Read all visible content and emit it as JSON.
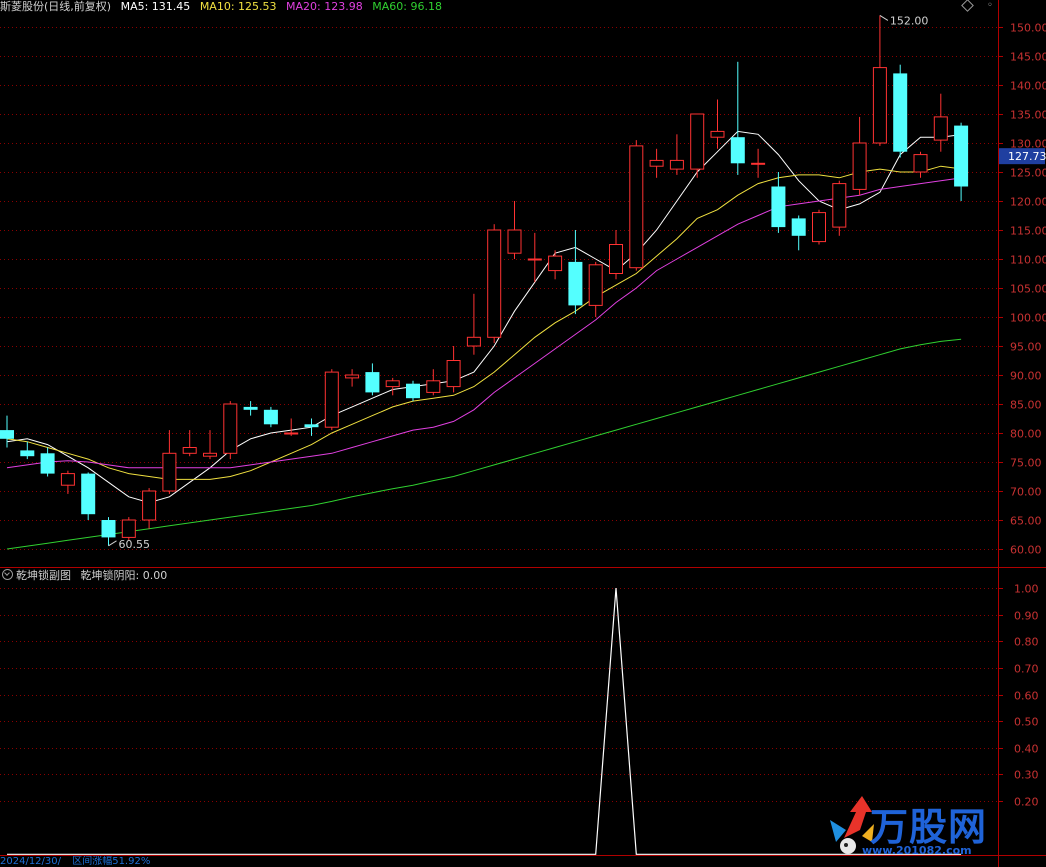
{
  "header": {
    "stock_label": "斯菱股份(日线,前复权)",
    "ma_items": [
      {
        "label": "MA5: 131.45",
        "color": "#ffffff"
      },
      {
        "label": "MA10: 125.53",
        "color": "#f0e040"
      },
      {
        "label": "MA20: 123.98",
        "color": "#e040e0"
      },
      {
        "label": "MA60: 96.18",
        "color": "#30d030"
      }
    ]
  },
  "sub_header": {
    "title": "乾坤锁副图",
    "value_label": "乾坤锁阴阳: 0.00"
  },
  "footer": {
    "date": "2024/12/30/",
    "change": "区间涨幅51.92%"
  },
  "watermark": {
    "brand": "万股网",
    "url": "www.201082.com"
  },
  "colors": {
    "up": "#ff3232",
    "down": "#54ffff",
    "grid": "#8a0000",
    "axis": "#b00000",
    "axis_text": "#c83232",
    "current_price_bg": "#1f3fa0"
  },
  "chart_data": [
    {
      "type": "candlestick",
      "title": "斯菱股份(日线,前复权)",
      "ylim": [
        57,
        155
      ],
      "y_ticks": [
        60,
        65,
        70,
        75,
        80,
        85,
        90,
        95,
        100,
        105,
        110,
        115,
        120,
        125,
        130,
        135,
        140,
        145,
        150
      ],
      "max_label": "152.00",
      "min_label": "60.55",
      "current_price_label": "127.73",
      "candles": [
        {
          "o": 80.5,
          "h": 83.0,
          "l": 77.5,
          "c": 79.0
        },
        {
          "o": 77.0,
          "h": 78.5,
          "l": 75.5,
          "c": 76.0
        },
        {
          "o": 76.5,
          "h": 77.5,
          "l": 72.5,
          "c": 73.0
        },
        {
          "o": 71.0,
          "h": 73.5,
          "l": 69.5,
          "c": 73.0
        },
        {
          "o": 73.0,
          "h": 73.2,
          "l": 65.0,
          "c": 66.0
        },
        {
          "o": 65.0,
          "h": 65.5,
          "l": 60.55,
          "c": 62.0
        },
        {
          "o": 62.0,
          "h": 65.5,
          "l": 61.5,
          "c": 65.0
        },
        {
          "o": 65.0,
          "h": 70.5,
          "l": 63.5,
          "c": 70.0
        },
        {
          "o": 70.0,
          "h": 80.5,
          "l": 69.5,
          "c": 76.5
        },
        {
          "o": 76.5,
          "h": 80.5,
          "l": 76.0,
          "c": 77.5
        },
        {
          "o": 76.0,
          "h": 80.5,
          "l": 75.5,
          "c": 76.5
        },
        {
          "o": 76.5,
          "h": 85.5,
          "l": 75.5,
          "c": 85.0
        },
        {
          "o": 84.5,
          "h": 85.5,
          "l": 83.0,
          "c": 84.0
        },
        {
          "o": 84.0,
          "h": 84.5,
          "l": 81.0,
          "c": 81.5
        },
        {
          "o": 80.0,
          "h": 82.5,
          "l": 79.5,
          "c": 80.0
        },
        {
          "o": 81.5,
          "h": 82.5,
          "l": 79.5,
          "c": 81.0
        },
        {
          "o": 81.0,
          "h": 91.0,
          "l": 80.5,
          "c": 90.5
        },
        {
          "o": 89.5,
          "h": 91.0,
          "l": 88.0,
          "c": 90.0
        },
        {
          "o": 90.5,
          "h": 92.0,
          "l": 86.5,
          "c": 87.0
        },
        {
          "o": 88.0,
          "h": 89.5,
          "l": 86.5,
          "c": 89.0
        },
        {
          "o": 88.5,
          "h": 89.0,
          "l": 85.5,
          "c": 86.0
        },
        {
          "o": 87.0,
          "h": 91.0,
          "l": 86.5,
          "c": 89.0
        },
        {
          "o": 88.0,
          "h": 95.0,
          "l": 87.0,
          "c": 92.5
        },
        {
          "o": 95.0,
          "h": 104.0,
          "l": 93.5,
          "c": 96.5
        },
        {
          "o": 96.5,
          "h": 116.0,
          "l": 95.5,
          "c": 115.0
        },
        {
          "o": 111.0,
          "h": 120.0,
          "l": 110.0,
          "c": 115.0
        },
        {
          "o": 110.0,
          "h": 114.5,
          "l": 106.0,
          "c": 110.0
        },
        {
          "o": 108.0,
          "h": 111.5,
          "l": 106.5,
          "c": 110.5
        },
        {
          "o": 109.5,
          "h": 115.0,
          "l": 100.5,
          "c": 102.0
        },
        {
          "o": 102.0,
          "h": 109.5,
          "l": 100.0,
          "c": 109.0
        },
        {
          "o": 107.5,
          "h": 115.0,
          "l": 106.5,
          "c": 112.5
        },
        {
          "o": 108.5,
          "h": 130.5,
          "l": 108.0,
          "c": 129.5
        },
        {
          "o": 126.0,
          "h": 129.0,
          "l": 124.0,
          "c": 127.0
        },
        {
          "o": 125.5,
          "h": 131.5,
          "l": 124.5,
          "c": 127.0
        },
        {
          "o": 125.5,
          "h": 135.0,
          "l": 124.0,
          "c": 135.0
        },
        {
          "o": 131.0,
          "h": 137.5,
          "l": 129.0,
          "c": 132.0
        },
        {
          "o": 131.0,
          "h": 144.0,
          "l": 124.5,
          "c": 126.5
        },
        {
          "o": 126.5,
          "h": 129.0,
          "l": 124.0,
          "c": 126.5
        },
        {
          "o": 122.5,
          "h": 125.0,
          "l": 114.5,
          "c": 115.5
        },
        {
          "o": 117.0,
          "h": 117.5,
          "l": 111.5,
          "c": 114.0
        },
        {
          "o": 113.0,
          "h": 118.5,
          "l": 112.5,
          "c": 118.0
        },
        {
          "o": 115.5,
          "h": 123.5,
          "l": 114.0,
          "c": 123.0
        },
        {
          "o": 122.0,
          "h": 134.5,
          "l": 121.0,
          "c": 130.0
        },
        {
          "o": 130.0,
          "h": 152.0,
          "l": 129.5,
          "c": 143.0
        },
        {
          "o": 142.0,
          "h": 143.5,
          "l": 127.5,
          "c": 128.5
        },
        {
          "o": 125.0,
          "h": 128.5,
          "l": 124.0,
          "c": 128.0
        },
        {
          "o": 130.5,
          "h": 138.5,
          "l": 128.5,
          "c": 134.5
        },
        {
          "o": 133.0,
          "h": 133.5,
          "l": 120.0,
          "c": 122.5
        }
      ],
      "moving_averages": [
        {
          "name": "MA5",
          "color": "#ffffff",
          "values": [
            78.5,
            79.0,
            78.0,
            76.0,
            74.0,
            71.5,
            69.0,
            68.0,
            69.0,
            71.5,
            74.0,
            77.0,
            79.0,
            80.0,
            80.5,
            81.0,
            83.0,
            84.5,
            86.0,
            87.5,
            88.0,
            88.5,
            89.0,
            90.5,
            95.0,
            101.0,
            106.0,
            111.0,
            112.0,
            110.0,
            108.0,
            111.0,
            115.0,
            120.0,
            125.0,
            128.5,
            132.0,
            131.5,
            128.0,
            123.5,
            120.0,
            118.5,
            119.5,
            121.5,
            128.0,
            131.0,
            131.0,
            131.45
          ]
        },
        {
          "name": "MA10",
          "color": "#f0e040",
          "values": [
            79.0,
            78.5,
            77.5,
            76.5,
            75.5,
            74.0,
            73.0,
            72.5,
            72.0,
            72.0,
            72.0,
            72.5,
            73.5,
            75.0,
            76.5,
            78.0,
            80.0,
            81.5,
            83.0,
            84.5,
            85.5,
            86.0,
            86.5,
            88.0,
            90.5,
            93.5,
            96.5,
            99.0,
            101.0,
            103.5,
            105.5,
            107.5,
            110.5,
            113.5,
            117.0,
            118.5,
            121.0,
            123.0,
            124.0,
            124.5,
            124.5,
            124.0,
            125.0,
            125.5,
            125.0,
            125.0,
            126.0,
            125.53
          ]
        },
        {
          "name": "MA20",
          "color": "#e040e0",
          "values": [
            74.0,
            74.5,
            75.0,
            75.2,
            75.0,
            74.5,
            74.0,
            74.0,
            74.0,
            74.0,
            74.0,
            74.0,
            74.5,
            75.0,
            75.5,
            76.0,
            76.5,
            77.5,
            78.5,
            79.5,
            80.5,
            81.0,
            82.0,
            84.0,
            87.0,
            89.5,
            92.0,
            94.5,
            97.0,
            99.5,
            102.5,
            105.0,
            108.0,
            110.0,
            112.0,
            114.0,
            116.0,
            117.5,
            119.0,
            119.5,
            120.0,
            120.5,
            121.0,
            122.0,
            122.5,
            123.0,
            123.5,
            123.98
          ]
        },
        {
          "name": "MA60",
          "color": "#30d030",
          "values": [
            60.0,
            60.5,
            61.0,
            61.5,
            62.0,
            62.5,
            63.0,
            63.5,
            64.0,
            64.5,
            65.0,
            65.5,
            66.0,
            66.5,
            67.0,
            67.5,
            68.2,
            69.0,
            69.7,
            70.4,
            71.0,
            71.8,
            72.5,
            73.5,
            74.5,
            75.5,
            76.5,
            77.5,
            78.5,
            79.5,
            80.5,
            81.5,
            82.5,
            83.5,
            84.5,
            85.5,
            86.5,
            87.5,
            88.5,
            89.5,
            90.5,
            91.5,
            92.5,
            93.5,
            94.5,
            95.2,
            95.8,
            96.18
          ]
        }
      ]
    },
    {
      "type": "line",
      "title": "乾坤锁副图",
      "ylim": [
        0,
        1.05
      ],
      "y_ticks": [
        0.2,
        0.3,
        0.4,
        0.5,
        0.6,
        0.7,
        0.8,
        0.9,
        1.0
      ],
      "series": [
        {
          "name": "乾坤锁阴阳",
          "color": "#ffffff",
          "values": [
            0,
            0,
            0,
            0,
            0,
            0,
            0,
            0,
            0,
            0,
            0,
            0,
            0,
            0,
            0,
            0,
            0,
            0,
            0,
            0,
            0,
            0,
            0,
            0,
            0,
            0,
            0,
            0,
            0,
            0,
            1,
            0,
            0,
            0,
            0,
            0,
            0,
            0,
            0,
            0,
            0,
            0,
            0,
            0,
            0,
            0,
            0,
            0
          ]
        }
      ]
    }
  ]
}
